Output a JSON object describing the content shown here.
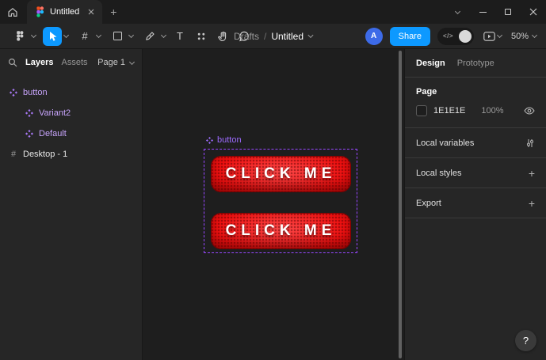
{
  "titlebar": {
    "tab_title": "Untitled",
    "new_tab_glyph": "+"
  },
  "toolbar": {
    "breadcrumb": {
      "project": "Drafts",
      "separator": "/",
      "file": "Untitled"
    },
    "avatar_initial": "A",
    "share_label": "Share",
    "dev_toggle_glyph": "</>",
    "zoom_level": "50%"
  },
  "icons": {
    "frame_tool_glyph": "#",
    "text_tool_glyph": "T",
    "frame_layer_glyph": "#",
    "plus_glyph": "+",
    "help_glyph": "?"
  },
  "left_panel": {
    "tab_layers": "Layers",
    "tab_assets": "Assets",
    "page_selector": "Page 1",
    "layers": [
      {
        "label": "button",
        "type": "component-set"
      },
      {
        "label": "Variant2",
        "type": "component"
      },
      {
        "label": "Default",
        "type": "component"
      },
      {
        "label": "Desktop - 1",
        "type": "frame"
      }
    ]
  },
  "canvas": {
    "selection_label": "button",
    "buttons": [
      {
        "label": "CLICK ME"
      },
      {
        "label": "CLICK ME"
      }
    ]
  },
  "right_panel": {
    "tab_design": "Design",
    "tab_prototype": "Prototype",
    "page_section_title": "Page",
    "page_color_hex": "1E1E1E",
    "page_opacity": "100%",
    "sections": {
      "local_variables": "Local variables",
      "local_styles": "Local styles",
      "export": "Export"
    }
  },
  "colors": {
    "accent_blue": "#0d99ff",
    "component_purple": "#9747ff",
    "canvas_bg": "#1e1e1e",
    "panel_bg": "#262626",
    "button_red": "#ee1010"
  }
}
